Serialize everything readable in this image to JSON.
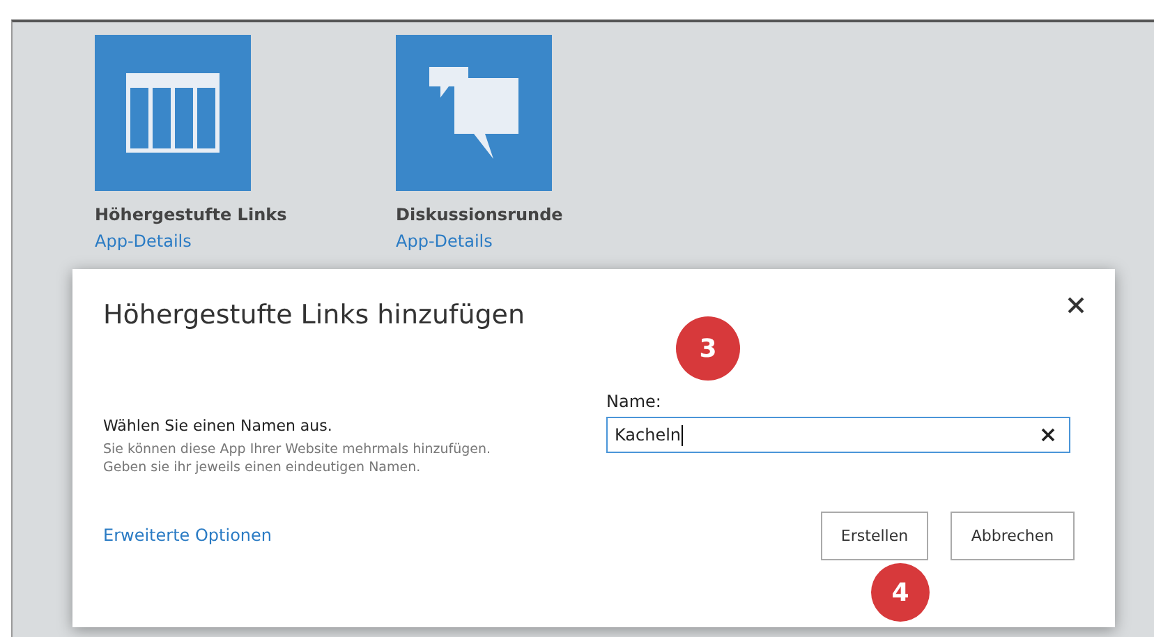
{
  "apps": [
    {
      "kind": "table",
      "title": "Höhergestufte Links",
      "link": "App-Details"
    },
    {
      "kind": "discussion",
      "title": "Diskussionsrunde",
      "link": "App-Details"
    }
  ],
  "dialog": {
    "title": "Höhergestufte Links hinzufügen",
    "heading": "Wählen Sie einen Namen aus.",
    "description": "Sie können diese App Ihrer Website mehrmals hinzufügen. Geben sie ihr jeweils einen eindeutigen Namen.",
    "field_label": "Name:",
    "field_value": "Kacheln",
    "advanced_link": "Erweiterte Optionen",
    "buttons": [
      "Erstellen",
      "Abbrechen"
    ]
  },
  "callouts": [
    "3",
    "4"
  ]
}
